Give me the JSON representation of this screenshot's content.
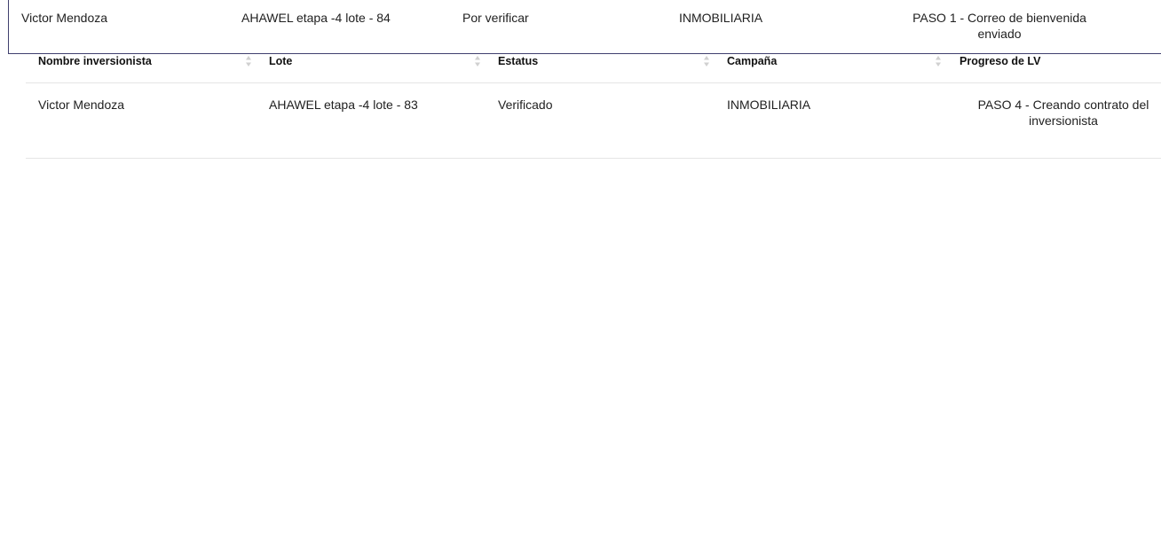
{
  "overlay_row": {
    "name": "Victor Mendoza",
    "lote": "AHAWEL etapa -4 lote - 84",
    "status": "Por verificar",
    "campaign": "INMOBILIARIA",
    "progress": "PASO 1 - Correo de bienvenida enviado"
  },
  "table": {
    "columns": [
      "Nombre inversionista",
      "Lote",
      "Estatus",
      "Campaña",
      "Progreso de LV"
    ],
    "rows": [
      {
        "name": "Victor Mendoza",
        "lote": "AHAWEL etapa -4 lote - 83",
        "status": "Verificado",
        "campaign": "INMOBILIARIA",
        "progress": "PASO 4 - Creando contrato del inversionista"
      }
    ]
  },
  "colors": {
    "overlay_border": "#3f3f6e",
    "row_divider": "#e5e5e5",
    "sort_icon": "#d0d0d0"
  }
}
